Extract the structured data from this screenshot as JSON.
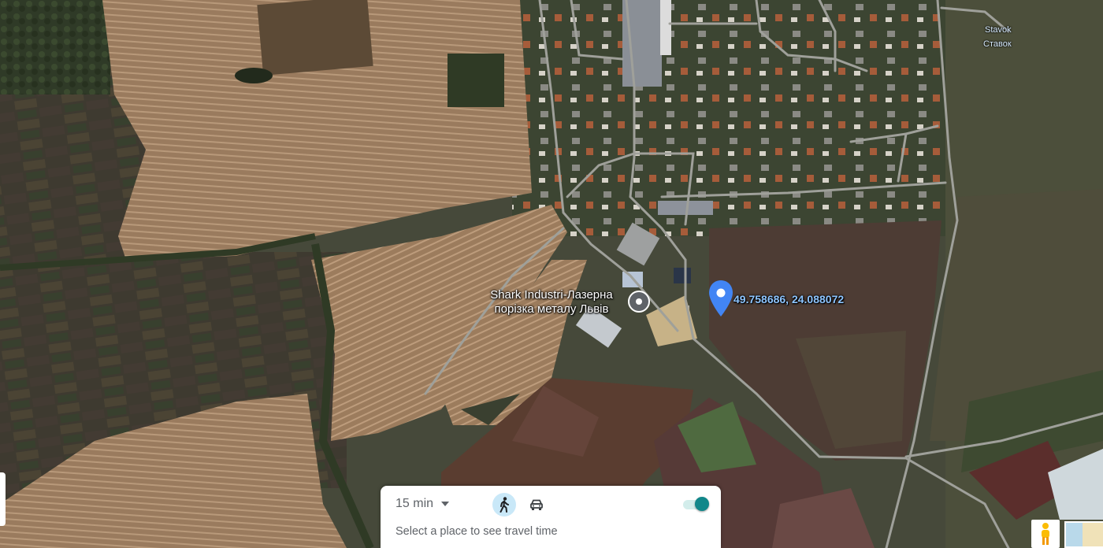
{
  "map": {
    "type": "satellite",
    "labels": {
      "poi_line1": "Shark Industri-Лазерна",
      "poi_line2": "порізка металу Львів",
      "village_latin": "Stavok",
      "village_cyrillic": "Ставок",
      "dropped_pin_coords": "49.758686, 24.088072"
    }
  },
  "travel_panel": {
    "duration": "15 min",
    "hint": "Select a place to see travel time",
    "modes": [
      "walking-icon",
      "car-icon"
    ],
    "selected_mode": "walking",
    "toggle_on": true,
    "accent_color": "#11878a"
  },
  "controls": [
    "pegman-icon",
    "layers-thumbnail"
  ],
  "colors": {
    "pin_blue": "#4285f4",
    "poi_gray": "#5f6368",
    "coords_text": "#8ec5ff"
  }
}
